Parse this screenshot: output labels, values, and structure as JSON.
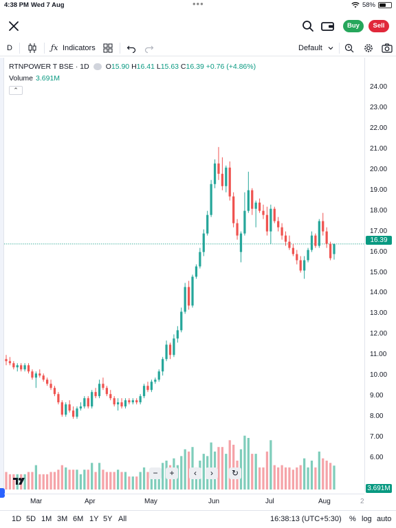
{
  "status_bar": {
    "time": "4:38 PM",
    "date": "Wed 7 Aug",
    "battery_percent": "58%",
    "battery_level": 0.58
  },
  "topbar": {
    "buy_label": "Buy",
    "sell_label": "Sell"
  },
  "toolbar": {
    "interval": "D",
    "indicators_label": "Indicators",
    "layout_label": "Default"
  },
  "legend": {
    "symbol": "RTNPOWER T BSE · 1D",
    "open_key": "O",
    "open": "15.90",
    "high_key": "H",
    "high": "16.41",
    "low_key": "L",
    "low": "15.63",
    "close_key": "C",
    "close": "16.39",
    "change": "+0.76 (+4.86%)",
    "volume_label": "Volume",
    "volume_value": "3.691M"
  },
  "price_axis": {
    "labels": [
      "24.00",
      "23.00",
      "22.00",
      "21.00",
      "20.00",
      "19.00",
      "18.00",
      "17.00",
      "16.00",
      "15.00",
      "14.00",
      "13.00",
      "12.00",
      "11.00",
      "10.00",
      "9.00",
      "8.00",
      "7.00",
      "6.00"
    ],
    "last_price": "16.39",
    "last_volume": "3.691M"
  },
  "time_axis": {
    "labels": [
      "Mar",
      "Apr",
      "May",
      "Jun",
      "Jul",
      "Aug",
      "2"
    ]
  },
  "bottom_bar": {
    "ranges": [
      "1D",
      "5D",
      "1M",
      "3M",
      "6M",
      "1Y",
      "5Y",
      "All"
    ],
    "clock": "16:38:13 (UTC+5:30)",
    "percent_label": "%",
    "log_label": "log",
    "auto_label": "auto"
  },
  "colors": {
    "up": "#26a69a",
    "down": "#ef5350",
    "up_volume": "#7fcdbb",
    "down_volume": "#f5a3a8",
    "last_price_line": "#089981",
    "buy": "#26a65b",
    "sell": "#e0283a"
  },
  "chart_data": {
    "type": "candlestick",
    "title": "RTNPOWER T BSE · 1D",
    "ylim": [
      5,
      24.5
    ],
    "x_months": [
      "Mar",
      "Apr",
      "May",
      "Jun",
      "Jul",
      "Aug"
    ],
    "candles": [
      {
        "o": 10.8,
        "h": 11.0,
        "l": 10.5,
        "c": 10.7
      },
      {
        "o": 10.7,
        "h": 10.9,
        "l": 10.5,
        "c": 10.6
      },
      {
        "o": 10.6,
        "h": 10.7,
        "l": 10.3,
        "c": 10.4
      },
      {
        "o": 10.4,
        "h": 10.6,
        "l": 10.2,
        "c": 10.5
      },
      {
        "o": 10.5,
        "h": 10.6,
        "l": 10.2,
        "c": 10.3
      },
      {
        "o": 10.3,
        "h": 10.6,
        "l": 10.2,
        "c": 10.5
      },
      {
        "o": 10.5,
        "h": 10.6,
        "l": 10.1,
        "c": 10.2
      },
      {
        "o": 10.2,
        "h": 10.3,
        "l": 9.8,
        "c": 9.9
      },
      {
        "o": 9.9,
        "h": 10.2,
        "l": 9.4,
        "c": 10.1
      },
      {
        "o": 10.1,
        "h": 10.3,
        "l": 9.9,
        "c": 10.0
      },
      {
        "o": 10.0,
        "h": 10.1,
        "l": 9.7,
        "c": 9.8
      },
      {
        "o": 9.8,
        "h": 9.9,
        "l": 9.5,
        "c": 9.6
      },
      {
        "o": 9.6,
        "h": 9.8,
        "l": 9.3,
        "c": 9.4
      },
      {
        "o": 9.4,
        "h": 9.5,
        "l": 9.0,
        "c": 9.1
      },
      {
        "o": 9.1,
        "h": 9.2,
        "l": 8.6,
        "c": 8.7
      },
      {
        "o": 8.7,
        "h": 8.8,
        "l": 8.0,
        "c": 8.1
      },
      {
        "o": 8.1,
        "h": 8.7,
        "l": 8.0,
        "c": 8.6
      },
      {
        "o": 8.6,
        "h": 8.8,
        "l": 8.2,
        "c": 8.3
      },
      {
        "o": 8.3,
        "h": 8.5,
        "l": 7.9,
        "c": 8.0
      },
      {
        "o": 8.0,
        "h": 8.5,
        "l": 7.9,
        "c": 8.4
      },
      {
        "o": 8.4,
        "h": 8.7,
        "l": 8.3,
        "c": 8.5
      },
      {
        "o": 8.5,
        "h": 9.0,
        "l": 8.4,
        "c": 8.9
      },
      {
        "o": 8.9,
        "h": 9.0,
        "l": 8.4,
        "c": 8.5
      },
      {
        "o": 8.5,
        "h": 9.3,
        "l": 8.4,
        "c": 9.2
      },
      {
        "o": 9.2,
        "h": 9.4,
        "l": 8.9,
        "c": 9.0
      },
      {
        "o": 9.0,
        "h": 9.8,
        "l": 8.9,
        "c": 9.6
      },
      {
        "o": 9.6,
        "h": 9.9,
        "l": 9.3,
        "c": 9.4
      },
      {
        "o": 9.4,
        "h": 9.5,
        "l": 9.0,
        "c": 9.1
      },
      {
        "o": 9.1,
        "h": 9.3,
        "l": 8.8,
        "c": 8.9
      },
      {
        "o": 8.9,
        "h": 9.0,
        "l": 8.5,
        "c": 8.6
      },
      {
        "o": 8.6,
        "h": 8.9,
        "l": 8.3,
        "c": 8.7
      },
      {
        "o": 8.7,
        "h": 8.9,
        "l": 8.4,
        "c": 8.5
      },
      {
        "o": 8.5,
        "h": 8.9,
        "l": 8.4,
        "c": 8.8
      },
      {
        "o": 8.8,
        "h": 8.9,
        "l": 8.6,
        "c": 8.7
      },
      {
        "o": 8.7,
        "h": 8.9,
        "l": 8.6,
        "c": 8.8
      },
      {
        "o": 8.8,
        "h": 8.9,
        "l": 8.6,
        "c": 8.7
      },
      {
        "o": 8.7,
        "h": 9.1,
        "l": 8.6,
        "c": 9.0
      },
      {
        "o": 9.0,
        "h": 9.6,
        "l": 8.9,
        "c": 9.5
      },
      {
        "o": 9.5,
        "h": 9.7,
        "l": 9.2,
        "c": 9.3
      },
      {
        "o": 9.3,
        "h": 9.8,
        "l": 9.2,
        "c": 9.7
      },
      {
        "o": 9.7,
        "h": 9.9,
        "l": 9.6,
        "c": 9.8
      },
      {
        "o": 9.8,
        "h": 10.3,
        "l": 9.7,
        "c": 10.2
      },
      {
        "o": 10.2,
        "h": 10.9,
        "l": 10.0,
        "c": 10.8
      },
      {
        "o": 10.8,
        "h": 11.7,
        "l": 10.7,
        "c": 11.5
      },
      {
        "o": 11.5,
        "h": 11.6,
        "l": 10.8,
        "c": 11.0
      },
      {
        "o": 11.0,
        "h": 12.0,
        "l": 10.9,
        "c": 11.8
      },
      {
        "o": 11.8,
        "h": 12.4,
        "l": 11.6,
        "c": 12.2
      },
      {
        "o": 12.2,
        "h": 13.3,
        "l": 12.1,
        "c": 13.1
      },
      {
        "o": 13.1,
        "h": 14.5,
        "l": 13.0,
        "c": 14.3
      },
      {
        "o": 14.3,
        "h": 14.6,
        "l": 13.2,
        "c": 13.4
      },
      {
        "o": 13.4,
        "h": 14.9,
        "l": 13.3,
        "c": 14.8
      },
      {
        "o": 14.8,
        "h": 15.4,
        "l": 14.7,
        "c": 15.3
      },
      {
        "o": 15.3,
        "h": 16.2,
        "l": 15.2,
        "c": 16.0
      },
      {
        "o": 16.0,
        "h": 17.1,
        "l": 15.8,
        "c": 16.9
      },
      {
        "o": 16.9,
        "h": 18.0,
        "l": 16.8,
        "c": 17.8
      },
      {
        "o": 17.8,
        "h": 19.5,
        "l": 17.7,
        "c": 19.3
      },
      {
        "o": 19.3,
        "h": 20.5,
        "l": 19.1,
        "c": 20.3
      },
      {
        "o": 20.3,
        "h": 21.1,
        "l": 19.5,
        "c": 19.8
      },
      {
        "o": 19.8,
        "h": 20.6,
        "l": 19.0,
        "c": 19.2
      },
      {
        "o": 19.2,
        "h": 20.2,
        "l": 18.9,
        "c": 20.1
      },
      {
        "o": 20.1,
        "h": 20.4,
        "l": 18.5,
        "c": 18.7
      },
      {
        "o": 18.7,
        "h": 18.9,
        "l": 17.2,
        "c": 17.4
      },
      {
        "o": 17.4,
        "h": 17.6,
        "l": 16.6,
        "c": 16.8
      },
      {
        "o": 16.0,
        "h": 17.0,
        "l": 15.5,
        "c": 16.9
      },
      {
        "o": 16.9,
        "h": 18.9,
        "l": 16.8,
        "c": 18.0
      },
      {
        "o": 18.0,
        "h": 19.9,
        "l": 17.9,
        "c": 19.0
      },
      {
        "o": 19.0,
        "h": 19.1,
        "l": 17.8,
        "c": 18.1
      },
      {
        "o": 18.1,
        "h": 18.5,
        "l": 17.2,
        "c": 18.4
      },
      {
        "o": 18.4,
        "h": 18.6,
        "l": 17.9,
        "c": 18.0
      },
      {
        "o": 18.0,
        "h": 18.3,
        "l": 17.6,
        "c": 17.8
      },
      {
        "o": 17.8,
        "h": 18.2,
        "l": 16.8,
        "c": 17.0
      },
      {
        "o": 17.0,
        "h": 18.3,
        "l": 16.4,
        "c": 18.1
      },
      {
        "o": 18.1,
        "h": 18.2,
        "l": 17.4,
        "c": 17.5
      },
      {
        "o": 17.5,
        "h": 17.7,
        "l": 17.0,
        "c": 17.2
      },
      {
        "o": 17.2,
        "h": 17.4,
        "l": 16.6,
        "c": 16.8
      },
      {
        "o": 16.8,
        "h": 17.0,
        "l": 16.3,
        "c": 16.5
      },
      {
        "o": 16.5,
        "h": 16.8,
        "l": 16.1,
        "c": 16.2
      },
      {
        "o": 16.2,
        "h": 16.4,
        "l": 15.8,
        "c": 15.9
      },
      {
        "o": 15.9,
        "h": 16.1,
        "l": 15.4,
        "c": 15.6
      },
      {
        "o": 15.6,
        "h": 15.8,
        "l": 15.0,
        "c": 15.1
      },
      {
        "o": 15.1,
        "h": 15.8,
        "l": 14.7,
        "c": 15.6
      },
      {
        "o": 15.6,
        "h": 16.2,
        "l": 15.5,
        "c": 16.1
      },
      {
        "o": 16.1,
        "h": 17.0,
        "l": 16.0,
        "c": 16.8
      },
      {
        "o": 16.8,
        "h": 16.9,
        "l": 16.2,
        "c": 16.3
      },
      {
        "o": 16.3,
        "h": 17.6,
        "l": 16.2,
        "c": 17.5
      },
      {
        "o": 17.5,
        "h": 17.9,
        "l": 16.8,
        "c": 17.0
      },
      {
        "o": 17.0,
        "h": 17.2,
        "l": 16.2,
        "c": 16.4
      },
      {
        "o": 16.4,
        "h": 16.5,
        "l": 15.6,
        "c": 15.7
      },
      {
        "o": 15.9,
        "h": 16.41,
        "l": 15.63,
        "c": 16.39
      }
    ],
    "volume_ylim": [
      0,
      10
    ]
  }
}
